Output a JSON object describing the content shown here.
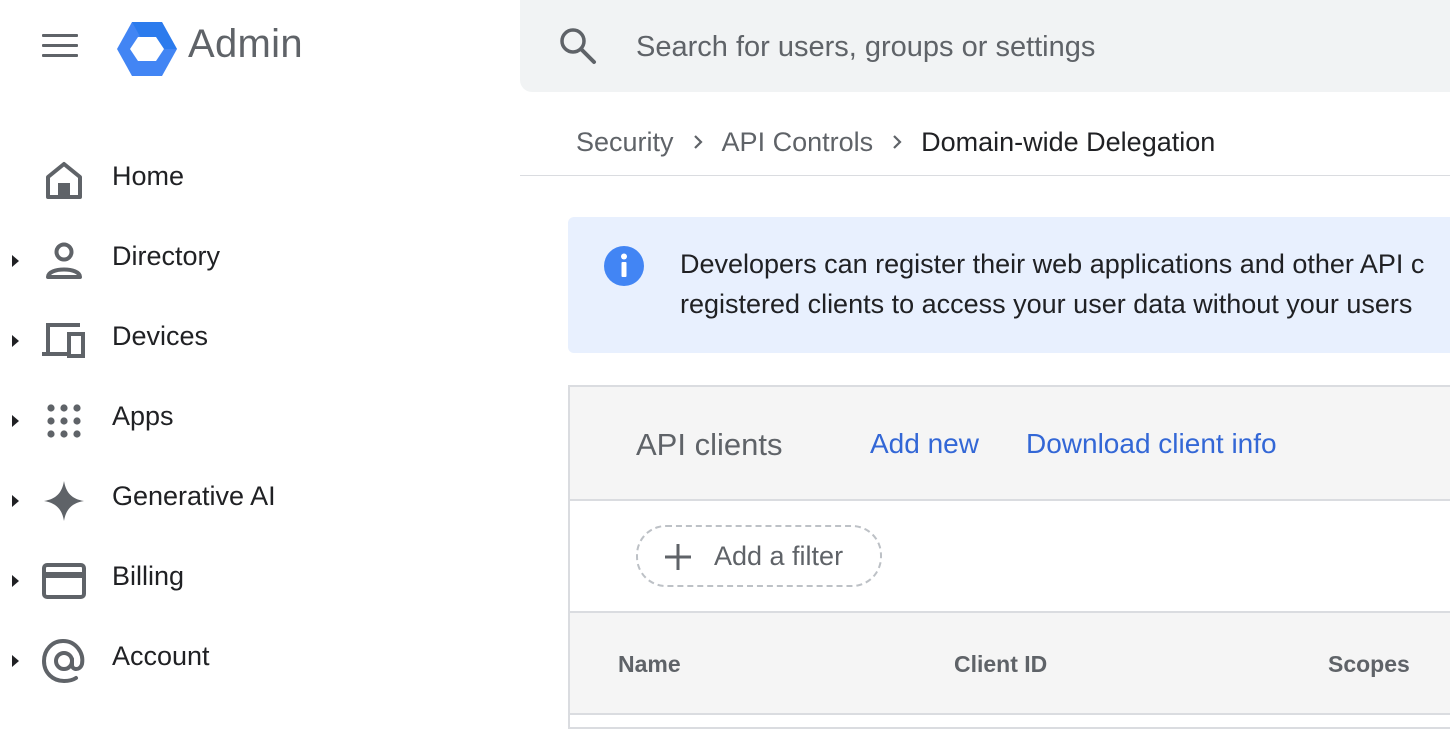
{
  "header": {
    "app_name": "Admin",
    "menu_icon": "hamburger-menu-icon",
    "logo_icon": "admin-logo-icon"
  },
  "search": {
    "placeholder": "Search for users, groups or settings",
    "value": "",
    "icon": "search-icon"
  },
  "breadcrumb": {
    "items": [
      "Security",
      "API Controls"
    ],
    "current": "Domain-wide Delegation"
  },
  "sidebar": {
    "items": [
      {
        "label": "Home",
        "icon": "home-icon",
        "expandable": false
      },
      {
        "label": "Directory",
        "icon": "person-icon",
        "expandable": true
      },
      {
        "label": "Devices",
        "icon": "devices-icon",
        "expandable": true
      },
      {
        "label": "Apps",
        "icon": "apps-grid-icon",
        "expandable": true
      },
      {
        "label": "Generative AI",
        "icon": "sparkle-icon",
        "expandable": true
      },
      {
        "label": "Billing",
        "icon": "credit-card-icon",
        "expandable": true
      },
      {
        "label": "Account",
        "icon": "at-sign-icon",
        "expandable": true
      }
    ]
  },
  "banner": {
    "line1": "Developers can register their web applications and other API c",
    "line2": "registered clients to access your user data without your users"
  },
  "api_clients": {
    "title": "API clients",
    "add_new": "Add new",
    "download": "Download client info",
    "filter_label": "Add a filter",
    "columns": [
      "Name",
      "Client ID",
      "Scopes"
    ]
  },
  "colors": {
    "accent": "#3367d6",
    "logo_blue": "#4285f4",
    "banner_bg": "#e8f0fe",
    "sidebar_icon": "#5f6368"
  }
}
